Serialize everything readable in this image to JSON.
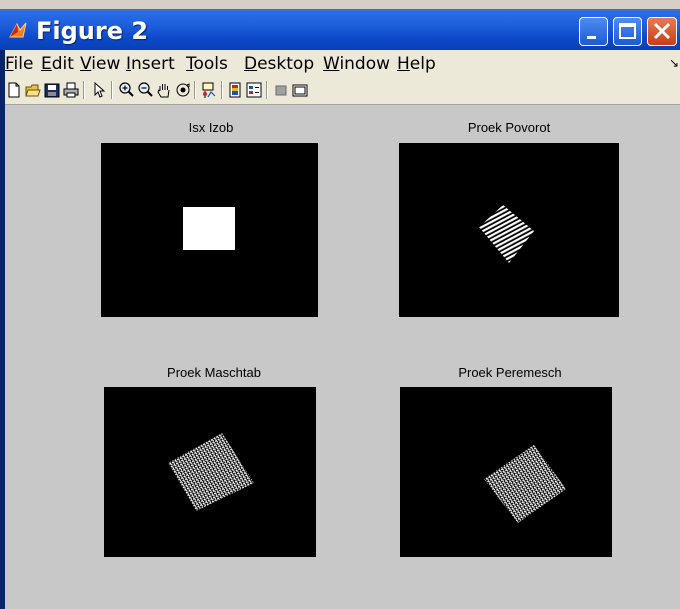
{
  "window": {
    "title": "Figure 2"
  },
  "menu": {
    "items": [
      {
        "key": "F",
        "rest": "ile"
      },
      {
        "key": "E",
        "rest": "dit"
      },
      {
        "key": "V",
        "rest": "iew"
      },
      {
        "key": "I",
        "rest": "nsert"
      },
      {
        "key": "T",
        "rest": "ools"
      },
      {
        "key": "D",
        "rest": "esktop"
      },
      {
        "key": "W",
        "rest": "indow"
      },
      {
        "key": "H",
        "rest": "elp"
      }
    ]
  },
  "toolbar": {
    "buttons": [
      "new-figure-icon",
      "open-file-icon",
      "save-icon",
      "print-icon",
      "edit-plot-arrow-icon",
      "zoom-in-icon",
      "zoom-out-icon",
      "pan-hand-icon",
      "rotate-3d-icon",
      "data-cursor-icon",
      "colorbar-icon",
      "legend-icon",
      "hide-plot-tools-icon",
      "show-plot-tools-icon"
    ]
  },
  "subplots": [
    {
      "title": "Isx Izob",
      "content": "white square"
    },
    {
      "title": "Proek Povorot",
      "content": "rotated striped square"
    },
    {
      "title": "Proek Maschtab",
      "content": "rotated noisy square"
    },
    {
      "title": "Proek Peremesch",
      "content": "rotated noisy square"
    }
  ],
  "colors": {
    "titlebar": "#0b49c9",
    "figure_background": "#c8c8c8",
    "axes_background": "#000000",
    "shape": "#ffffff"
  }
}
